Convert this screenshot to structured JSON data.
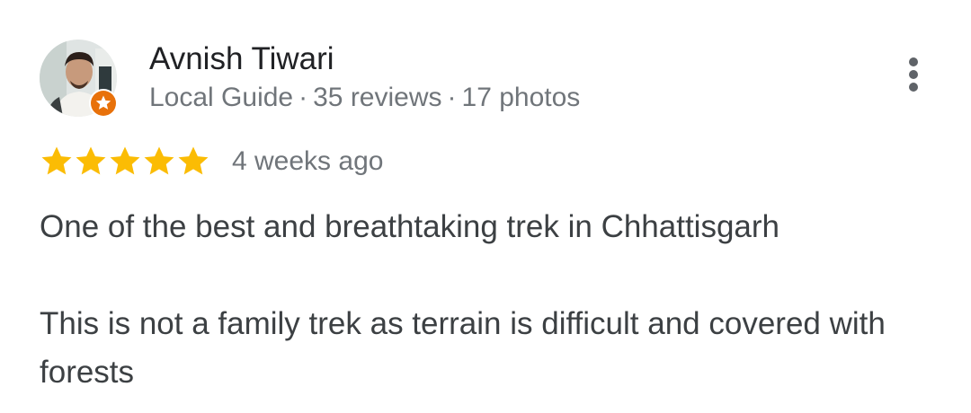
{
  "reviewer": {
    "name": "Avnish Tiwari",
    "badge": "Local Guide",
    "reviews": "35 reviews",
    "photos": "17 photos",
    "separator": "·"
  },
  "rating": {
    "stars": 5,
    "max_stars": 5,
    "time_ago": "4 weeks ago"
  },
  "review": {
    "paragraphs": [
      "One of the best and breathtaking trek in Chhattisgarh",
      "This is not a family trek as terrain is difficult and covered with forests"
    ]
  },
  "icons": {
    "menu": "more-vert-icon",
    "badge": "local-guide-star-icon",
    "star": "star-icon"
  },
  "colors": {
    "star": "#fbbc04",
    "badge": "#e8710a",
    "name": "#202124",
    "secondary": "#70757a",
    "body": "#3c4043"
  }
}
